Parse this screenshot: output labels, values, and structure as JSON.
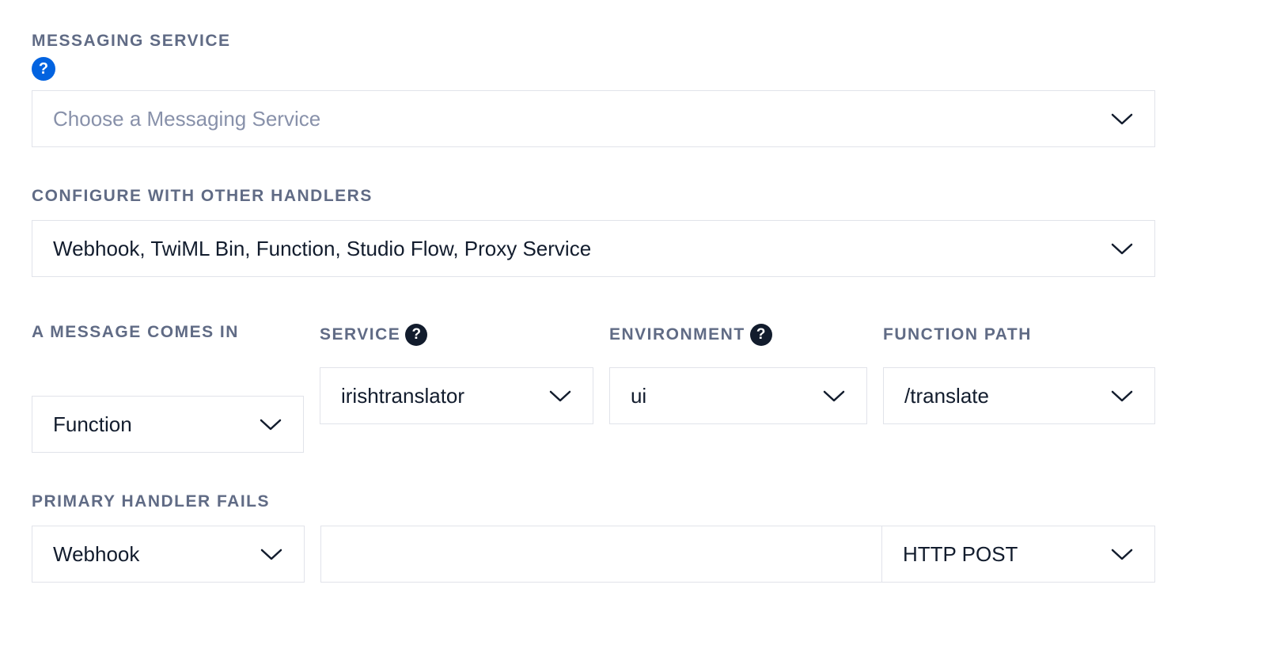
{
  "messaging_service": {
    "label": "MESSAGING SERVICE",
    "placeholder": "Choose a Messaging Service",
    "value": ""
  },
  "configure_with": {
    "label": "CONFIGURE WITH OTHER HANDLERS",
    "value": "Webhook, TwiML Bin, Function, Studio Flow, Proxy Service"
  },
  "message_comes_in": {
    "label": "A MESSAGE COMES IN",
    "value": "Function"
  },
  "service": {
    "label": "SERVICE",
    "value": "irishtranslator"
  },
  "environment": {
    "label": "ENVIRONMENT",
    "value": "ui"
  },
  "function_path": {
    "label": "FUNCTION PATH",
    "value": "/translate"
  },
  "primary_handler_fails": {
    "label": "PRIMARY HANDLER FAILS",
    "type_value": "Webhook",
    "url_value": "",
    "method_value": "HTTP POST"
  },
  "icons": {
    "help": "?"
  }
}
